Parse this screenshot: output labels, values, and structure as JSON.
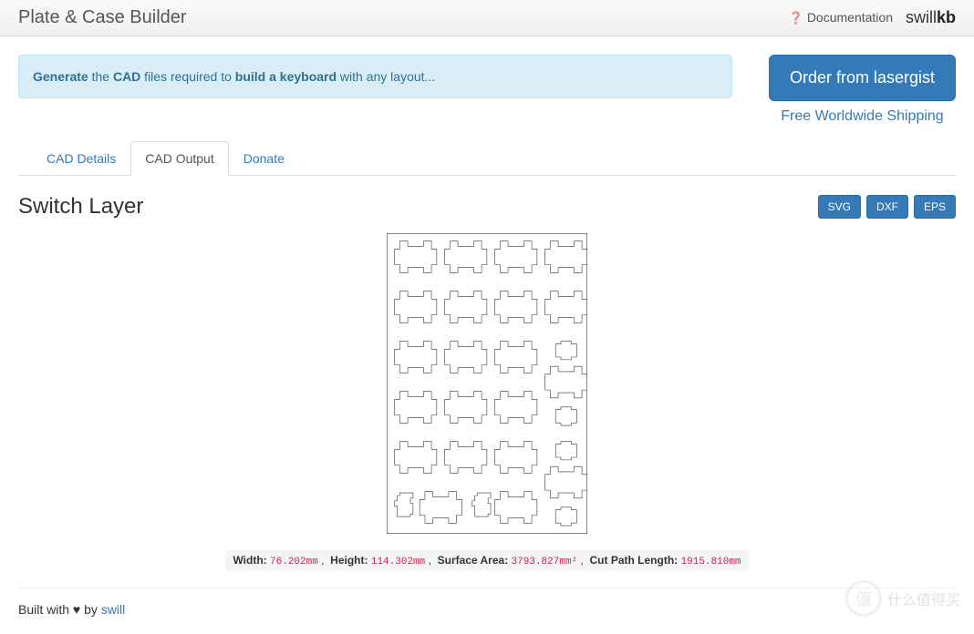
{
  "header": {
    "title": "Plate & Case Builder",
    "documentation": "Documentation",
    "brand_part1": "swill",
    "brand_part2": "kb"
  },
  "alert": {
    "word_generate": "Generate",
    "word_the": " the ",
    "word_cad": "CAD",
    "word_files": " files required to ",
    "word_build": "build a keyboard",
    "word_layout": " with any layout..."
  },
  "order": {
    "button": "Order from lasergist",
    "shipping": "Free Worldwide Shipping"
  },
  "tabs": {
    "details": "CAD Details",
    "output": "CAD Output",
    "donate": "Donate"
  },
  "section": {
    "title": "Switch Layer",
    "formats": [
      "SVG",
      "DXF",
      "EPS"
    ]
  },
  "stats": {
    "width_label": "Width:",
    "width_value": "76.202mm",
    "height_label": "Height:",
    "height_value": "114.302mm",
    "area_label": "Surface Area:",
    "area_value": "3793.827mm²",
    "cut_label": "Cut Path Length:",
    "cut_value": "1915.810mm"
  },
  "footer": {
    "built": "Built with ",
    "by": " by ",
    "author": "swill"
  },
  "watermark": "什么值得买"
}
